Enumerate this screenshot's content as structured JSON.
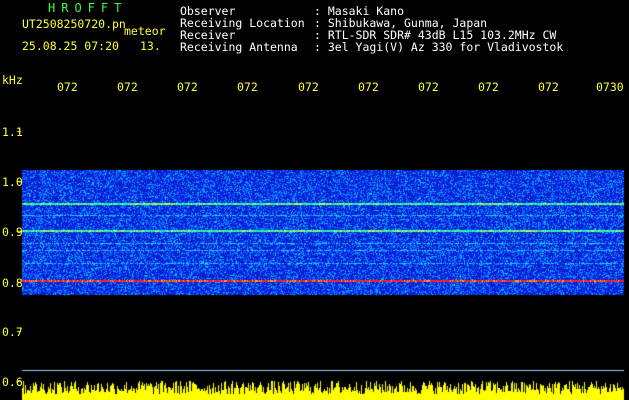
{
  "header": {
    "brand": "HROFFT",
    "filename": "UT2508250720.pn",
    "mode": "meteor",
    "datetime": "25.08.25 07:20",
    "count": "13.",
    "labels": {
      "observer": "Observer",
      "location": "Receiving Location",
      "receiver": "Receiver",
      "antenna": "Receiving Antenna"
    },
    "values": {
      "observer": ": Masaki Kano",
      "location": ": Shibukawa, Gunma, Japan",
      "receiver": ": RTL-SDR SDR# 43dB L15 103.2MHz CW",
      "antenna": ": 3el Yagi(V) Az 330 for Vladivostok"
    }
  },
  "time_axis": {
    "ticks": [
      "072",
      "072",
      "072",
      "072",
      "072",
      "072",
      "072",
      "072",
      "072",
      "0730"
    ]
  },
  "freq_axis": {
    "unit": "kHz",
    "ticks": [
      "1.1",
      "1.0",
      "0.9",
      "0.8",
      "0.7",
      "0.6"
    ]
  },
  "colors": {
    "background": "#000000",
    "text": "#ffffff",
    "accent": "#ffff33",
    "brand": "#33ff33",
    "signal_low": "#0a1bd0",
    "signal_mid": "#00c8ff",
    "signal_high": "#ff2020",
    "power_trace": "#ffff00"
  },
  "spectrogram": {
    "band_top_khz": 1.02,
    "band_bottom_khz": 0.77,
    "carrier_khz": 0.8,
    "strong_lines_khz": [
      0.8,
      0.9,
      0.955
    ],
    "weak_lines_khz": [
      0.835,
      0.86,
      0.875,
      0.93
    ]
  }
}
